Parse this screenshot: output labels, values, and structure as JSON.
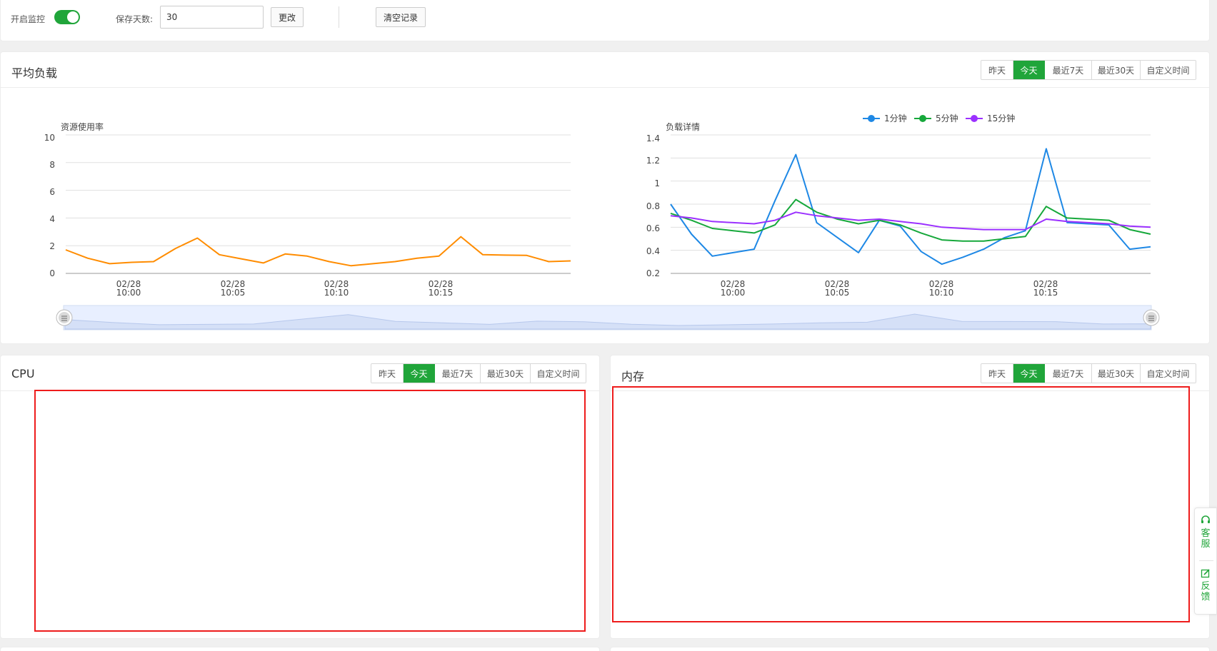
{
  "toolbar": {
    "monitor_label": "开启监控",
    "monitor_on": true,
    "days_label": "保存天数:",
    "days_value": "30",
    "change_button": "更改",
    "clear_button": "清空记录"
  },
  "range_tabs": [
    "昨天",
    "今天",
    "最近7天",
    "最近30天",
    "自定义时间"
  ],
  "active_range": "今天",
  "colors": {
    "accent": "#20a53a",
    "red_box": "#ee1c1c"
  },
  "load_panel": {
    "title": "平均负载",
    "usage_chart": {
      "label": "资源使用率",
      "y_ticks": [
        "0",
        "2",
        "4",
        "6",
        "8",
        "10"
      ],
      "x_ticks": [
        [
          "02/28",
          "10:00"
        ],
        [
          "02/28",
          "10:05"
        ],
        [
          "02/28",
          "10:10"
        ],
        [
          "02/28",
          "10:15"
        ]
      ]
    },
    "detail_chart": {
      "label": "负载详情",
      "y_ticks": [
        "0.2",
        "0.4",
        "0.6",
        "0.8",
        "1",
        "1.2",
        "1.4"
      ],
      "x_ticks": [
        [
          "02/28",
          "10:00"
        ],
        [
          "02/28",
          "10:05"
        ],
        [
          "02/28",
          "10:10"
        ],
        [
          "02/28",
          "10:15"
        ]
      ],
      "legend": [
        "1分钟",
        "5分钟",
        "15分钟"
      ]
    }
  },
  "chart_data": [
    {
      "type": "line",
      "title": "资源使用率",
      "xlabel": "",
      "ylabel": "",
      "ylim": [
        0,
        10
      ],
      "x_tick_labels": [
        "02/28 10:00",
        "02/28 10:05",
        "02/28 10:10",
        "02/28 10:15"
      ],
      "grid": true,
      "series": [
        {
          "color": "#ff8c00",
          "values": [
            1.7,
            1.1,
            0.7,
            0.8,
            0.85,
            1.8,
            2.55,
            1.35,
            1.05,
            0.75,
            1.4,
            1.25,
            0.85,
            0.55,
            0.7,
            0.85,
            1.1,
            1.25,
            2.65,
            1.35,
            1.32,
            1.3,
            0.85,
            0.9
          ]
        }
      ]
    },
    {
      "type": "line",
      "title": "负载详情",
      "xlabel": "",
      "ylabel": "",
      "ylim": [
        0.2,
        1.4
      ],
      "x_tick_labels": [
        "02/28 10:00",
        "02/28 10:05",
        "02/28 10:10",
        "02/28 10:15"
      ],
      "legend_position": "top",
      "grid": true,
      "series": [
        {
          "name": "1分钟",
          "color": "#1e88e5",
          "values": [
            0.8,
            0.54,
            0.35,
            0.38,
            0.41,
            0.83,
            1.23,
            0.64,
            0.51,
            0.38,
            0.66,
            0.61,
            0.39,
            0.28,
            0.34,
            0.41,
            0.51,
            0.57,
            1.28,
            0.64,
            0.63,
            0.62,
            0.41,
            0.43
          ]
        },
        {
          "name": "5分钟",
          "color": "#16a83b",
          "values": [
            0.72,
            0.66,
            0.59,
            0.57,
            0.55,
            0.62,
            0.84,
            0.73,
            0.67,
            0.63,
            0.66,
            0.62,
            0.55,
            0.49,
            0.48,
            0.48,
            0.5,
            0.52,
            0.78,
            0.68,
            0.67,
            0.66,
            0.58,
            0.54
          ]
        },
        {
          "name": "15分钟",
          "color": "#9b30ff",
          "values": [
            0.7,
            0.68,
            0.65,
            0.64,
            0.63,
            0.66,
            0.73,
            0.7,
            0.68,
            0.66,
            0.67,
            0.65,
            0.63,
            0.6,
            0.59,
            0.58,
            0.58,
            0.58,
            0.67,
            0.65,
            0.64,
            0.63,
            0.61,
            0.6
          ]
        }
      ]
    }
  ],
  "cpu_panel": {
    "title": "CPU"
  },
  "mem_panel": {
    "title": "内存"
  },
  "float_widget": {
    "service_label": "客服",
    "feedback_label": "反馈"
  }
}
